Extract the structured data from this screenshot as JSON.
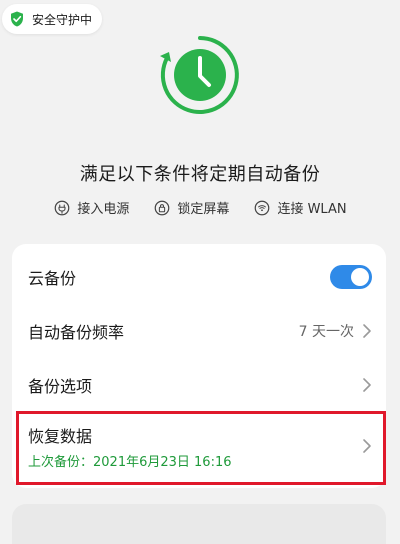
{
  "security_badge": {
    "text": "安全守护中",
    "icon": "shield-check-icon",
    "color": "#2bb24c"
  },
  "illustration": {
    "icon": "clock-refresh-icon",
    "color": "#2bb24c"
  },
  "headline": "满足以下条件将定期自动备份",
  "conditions": [
    {
      "icon": "plug-icon",
      "label": "接入电源"
    },
    {
      "icon": "lock-icon",
      "label": "锁定屏幕"
    },
    {
      "icon": "wifi-icon",
      "label": "连接 WLAN"
    }
  ],
  "settings": {
    "cloud_backup": {
      "label": "云备份",
      "enabled": true,
      "toggle_color": "#2f8ae8"
    },
    "frequency": {
      "label": "自动备份频率",
      "value": "7 天一次"
    },
    "options": {
      "label": "备份选项"
    },
    "restore": {
      "label": "恢复数据",
      "last_backup": "上次备份：2021年6月23日 16:16",
      "last_backup_color": "#1f9a3a"
    }
  },
  "highlight_color": "#e0182b"
}
